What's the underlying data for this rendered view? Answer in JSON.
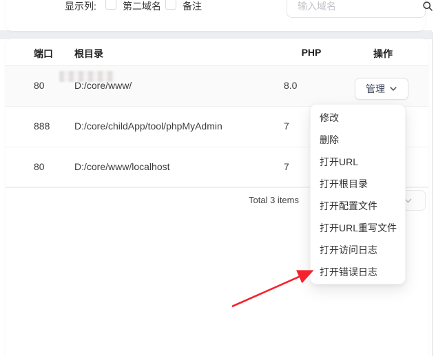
{
  "filter_bar": {
    "label": "显示列:",
    "checkboxes": [
      {
        "label": "第二域名",
        "checked": false
      },
      {
        "label": "备注",
        "checked": false
      }
    ],
    "search": {
      "placeholder": "输入域名",
      "icon": "search-icon"
    }
  },
  "table": {
    "columns": [
      {
        "key": "port",
        "label": "端口"
      },
      {
        "key": "root",
        "label": "根目录"
      },
      {
        "key": "php",
        "label": "PHP"
      },
      {
        "key": "action",
        "label": "操作"
      }
    ],
    "rows": [
      {
        "port": "80",
        "root": "D:/core/www/",
        "root_redacted": true,
        "php": "8.0",
        "action_label": "管理"
      },
      {
        "port": "888",
        "root": "D:/core/childApp/tool/phpMyAdmin",
        "php": "7"
      },
      {
        "port": "80",
        "root": "D:/core/www/localhost",
        "php": "7"
      }
    ],
    "footer": {
      "total_text": "Total 3 items",
      "page_size_select_icon": "chevron-down-icon"
    }
  },
  "dropdown_menu": {
    "items": [
      "修改",
      "删除",
      "打开URL",
      "打开根目录",
      "打开配置文件",
      "打开URL重写文件",
      "打开访问日志",
      "打开错误日志"
    ],
    "arrow_points_to": "打开错误日志"
  },
  "colors": {
    "arrow_red": "#f5222d",
    "row_hover_bg": "#fafafa",
    "divider": "#f0f0f0",
    "band_bg": "#edeef2",
    "manage_text": "#3b4256"
  }
}
